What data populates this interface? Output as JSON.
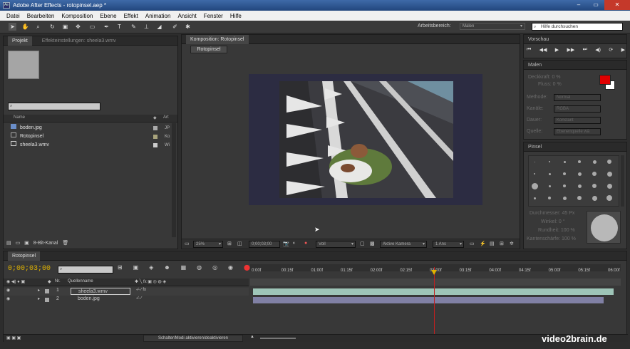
{
  "window": {
    "title": "Adobe After Effects - rotopinsel.aep *",
    "buttons": [
      "–",
      "▭",
      "✕"
    ]
  },
  "menu": [
    "Datei",
    "Bearbeiten",
    "Komposition",
    "Ebene",
    "Effekt",
    "Animation",
    "Ansicht",
    "Fenster",
    "Hilfe"
  ],
  "toolbar": {
    "workspace_label": "Arbeitsbereich:",
    "workspace_value": "Malen",
    "search_placeholder": "Hilfe durchsuchen"
  },
  "project": {
    "tab": "Projekt",
    "effects_tab": "Effekteinstellungen: sheela3.wmv",
    "col_name": "Name",
    "col_type": "Art",
    "items": [
      {
        "name": "boden.jpg",
        "type": "JP"
      },
      {
        "name": "Rotopinsel",
        "type": "Ko"
      },
      {
        "name": "sheela3.wmv",
        "type": "Wi"
      }
    ],
    "bitdepth": "8-Bit-Kanal"
  },
  "composition": {
    "tab": "Komposition: Rotopinsel",
    "subtab": "Rotopinsel",
    "zoom": "25%",
    "timecode": "0;00;03;00",
    "resolution": "Voll",
    "camera": "Aktive Kamera",
    "views": "1 Ans"
  },
  "preview": {
    "title": "Vorschau"
  },
  "paint": {
    "title": "Malen",
    "opacity_label": "Deckkraft:",
    "opacity_value": "0 %",
    "flow_label": "Fluss:",
    "flow_value": "0 %",
    "mode_label": "Methode:",
    "mode_value": "Normal",
    "channels_label": "Kanäle:",
    "channels_value": "RGBA",
    "duration_label": "Dauer:",
    "duration_value": "Konstant",
    "clone_label": "Quelle:",
    "clone_value": "Ebenenquelle wä",
    "color_fg": "#e00000",
    "color_bg": "#ffffff"
  },
  "brush": {
    "title": "Pinsel",
    "diameter": "Durchmesser: 45 Px",
    "angle": "Winkel: 0 °",
    "roundness": "Rundheit: 100 %",
    "hardness": "Kantenschärfe: 100 %"
  },
  "timeline": {
    "tab": "Rotopinsel",
    "timecode": "0;00;03;00",
    "col_nr": "Nr.",
    "col_source": "Quellenname",
    "layers": [
      {
        "nr": "1",
        "name": "sheela3.wmv"
      },
      {
        "nr": "2",
        "name": "boden.jpg"
      }
    ],
    "ruler": [
      "0:00f",
      "00:15f",
      "01:00f",
      "01:15f",
      "02:00f",
      "02:15f",
      "03:00f",
      "03:15f",
      "04:00f",
      "04:15f",
      "05:00f",
      "05:15f",
      "06:00f"
    ],
    "footer_toggle": "Schalter/Modi aktivieren/deaktivieren",
    "playhead_fraction": 0.5
  },
  "watermark": "video2brain.de"
}
